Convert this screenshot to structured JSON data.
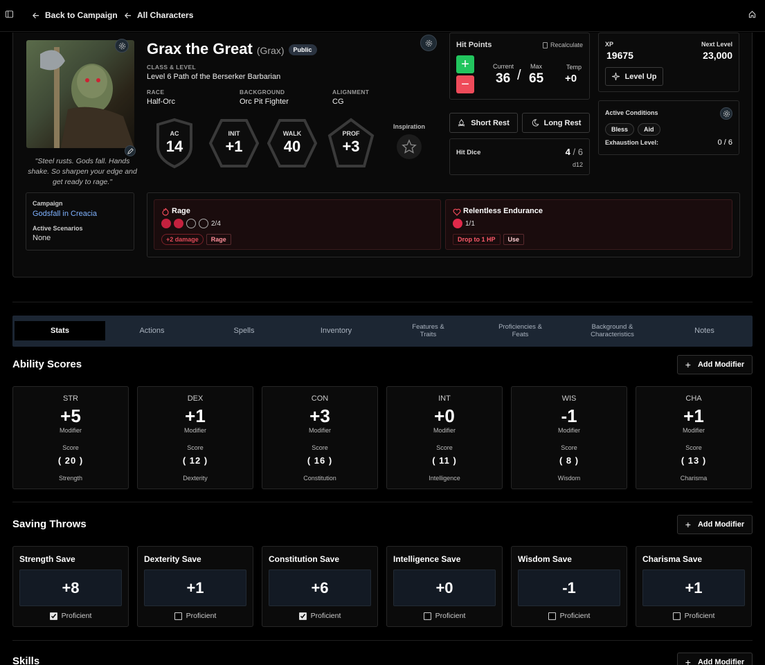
{
  "nav": {
    "back_campaign": "Back to Campaign",
    "all_characters": "All Characters"
  },
  "character": {
    "name": "Grax the Great",
    "alias": "(Grax)",
    "visibility": "Public",
    "class_label": "CLASS & LEVEL",
    "class_value": "Level 6 Path of the Berserker Barbarian",
    "race_label": "RACE",
    "race": "Half-Orc",
    "background_label": "BACKGROUND",
    "background": "Orc Pit Fighter",
    "alignment_label": "ALIGNMENT",
    "alignment": "CG",
    "quote": "\"Steel rusts. Gods fall. Hands shake. So sharpen your edge and get ready to rage.\""
  },
  "stats": {
    "ac_label": "AC",
    "ac": "14",
    "init_label": "INIT",
    "init": "+1",
    "walk_label": "WALK",
    "walk": "40",
    "prof_label": "PROF",
    "prof": "+3",
    "inspiration_label": "Inspiration"
  },
  "hp": {
    "title": "Hit Points",
    "recalculate": "Recalculate",
    "current_label": "Current",
    "current": "36",
    "sep": "/",
    "max_label": "Max",
    "max": "65",
    "temp_label": "Temp",
    "temp": "+0",
    "plus": "+",
    "minus": "−"
  },
  "rest": {
    "short": "Short Rest",
    "long": "Long Rest"
  },
  "hit_dice": {
    "title": "Hit Dice",
    "value": "4",
    "max": "/ 6",
    "die": "d12"
  },
  "xp": {
    "label": "XP",
    "value": "19675",
    "next_label": "Next Level",
    "next": "23,000",
    "level_up": "Level Up"
  },
  "conditions": {
    "title": "Active Conditions",
    "items": [
      "Bless",
      "Aid"
    ],
    "exhaustion_label": "Exhaustion Level:",
    "exhaustion": "0 / 6"
  },
  "campaign": {
    "label": "Campaign",
    "name": "Godsfall in Creacia",
    "scen_label": "Active Scenarios",
    "scen": "None"
  },
  "resources": [
    {
      "name": "Rage",
      "count": "2/4",
      "used": 2,
      "total": 4,
      "tags": [
        "+2 damage"
      ],
      "action": "Rage"
    },
    {
      "name": "Relentless Endurance",
      "count": "1/1",
      "used": 1,
      "total": 1,
      "tags": [
        "Drop to 1 HP"
      ],
      "action": "Use"
    }
  ],
  "tabs": [
    "Stats",
    "Actions",
    "Spells",
    "Inventory",
    "Features &\nTraits",
    "Proficiencies &\nFeats",
    "Background &\nCharacteristics",
    "Notes"
  ],
  "sections": {
    "ability": "Ability Scores",
    "saving": "Saving Throws",
    "skills": "Skills",
    "add_modifier": "Add Modifier"
  },
  "abilities": [
    {
      "abbr": "STR",
      "mod": "+5",
      "score": "( 20 )",
      "name": "Strength"
    },
    {
      "abbr": "DEX",
      "mod": "+1",
      "score": "( 12 )",
      "name": "Dexterity"
    },
    {
      "abbr": "CON",
      "mod": "+3",
      "score": "( 16 )",
      "name": "Constitution"
    },
    {
      "abbr": "INT",
      "mod": "+0",
      "score": "( 11 )",
      "name": "Intelligence"
    },
    {
      "abbr": "WIS",
      "mod": "-1",
      "score": "( 8 )",
      "name": "Wisdom"
    },
    {
      "abbr": "CHA",
      "mod": "+1",
      "score": "( 13 )",
      "name": "Charisma"
    }
  ],
  "ability_labels": {
    "modifier": "Modifier",
    "score": "Score"
  },
  "saves": [
    {
      "name": "Strength Save",
      "value": "+8",
      "proficient": true
    },
    {
      "name": "Dexterity Save",
      "value": "+1",
      "proficient": false
    },
    {
      "name": "Constitution Save",
      "value": "+6",
      "proficient": true
    },
    {
      "name": "Intelligence Save",
      "value": "+0",
      "proficient": false
    },
    {
      "name": "Wisdom Save",
      "value": "-1",
      "proficient": false
    },
    {
      "name": "Charisma Save",
      "value": "+1",
      "proficient": false
    }
  ],
  "proficient_label": "Proficient",
  "colors": {
    "accent_red": "#e0294a",
    "green": "#22c55e",
    "red_btn": "#ef4b5a",
    "link": "#7fb2ff"
  }
}
